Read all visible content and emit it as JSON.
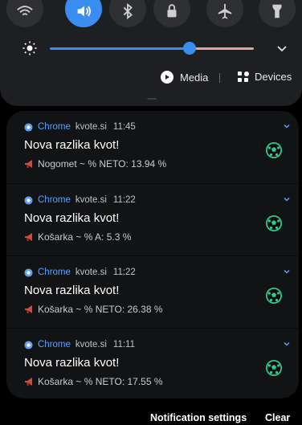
{
  "quick_settings": {
    "toggles": [
      {
        "icon": "wifi-icon",
        "active": false
      },
      {
        "icon": "sound-icon",
        "active": true
      },
      {
        "icon": "bluetooth-icon",
        "active": false
      },
      {
        "icon": "lock-icon",
        "active": false
      },
      {
        "icon": "airplane-icon",
        "active": false
      },
      {
        "icon": "flashlight-icon",
        "active": false
      }
    ],
    "brightness_level": 0.65,
    "media_label": "Media",
    "devices_label": "Devices",
    "accent_color": "#3a8ef2"
  },
  "notifications": [
    {
      "app": "Chrome",
      "domain": "kvote.si",
      "time": "11:45",
      "title": "Nova razlika kvot!",
      "body": "Nogomet ~ % NETO: 13.94 %"
    },
    {
      "app": "Chrome",
      "domain": "kvote.si",
      "time": "11:22",
      "title": "Nova razlika kvot!",
      "body": "Košarka ~ % A: 5.3 %"
    },
    {
      "app": "Chrome",
      "domain": "kvote.si",
      "time": "11:22",
      "title": "Nova razlika kvot!",
      "body": "Košarka ~ % NETO: 26.38 %"
    },
    {
      "app": "Chrome",
      "domain": "kvote.si",
      "time": "11:11",
      "title": "Nova razlika kvot!",
      "body": "Košarka ~ % NETO: 17.55 %"
    }
  ],
  "footer": {
    "settings_label": "Notification settings",
    "clear_label": "Clear"
  }
}
